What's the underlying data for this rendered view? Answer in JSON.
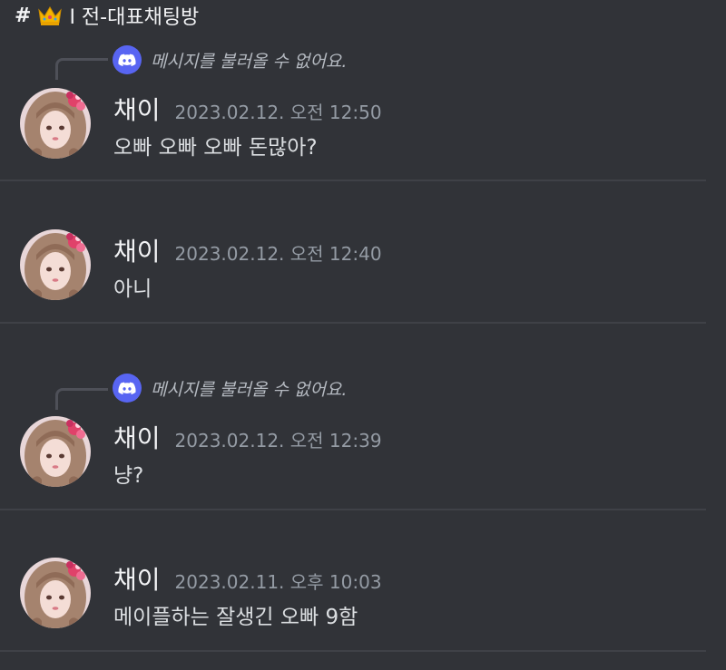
{
  "channel": {
    "hash": "#",
    "crown_icon": "crown-icon",
    "name": "I 전-대표채팅방"
  },
  "colors": {
    "background": "#313338",
    "divider": "#3f4147",
    "discord_blue": "#5865f2",
    "text_primary": "#f2f3f5",
    "text_muted": "#949ba4"
  },
  "messages": [
    {
      "reply_text": "메시지를 불러올 수 없어요.",
      "username": "채이",
      "timestamp": "2023.02.12. 오전 12:50",
      "content": "오빠 오빠 오빠 돈많아?"
    },
    {
      "username": "채이",
      "timestamp": "2023.02.12. 오전 12:40",
      "content": "아니"
    },
    {
      "reply_text": "메시지를 불러올 수 없어요.",
      "username": "채이",
      "timestamp": "2023.02.12. 오전 12:39",
      "content": "냥?"
    },
    {
      "username": "채이",
      "timestamp": "2023.02.11. 오후 10:03",
      "content": "메이플하는 잘생긴 오빠 9함"
    }
  ]
}
